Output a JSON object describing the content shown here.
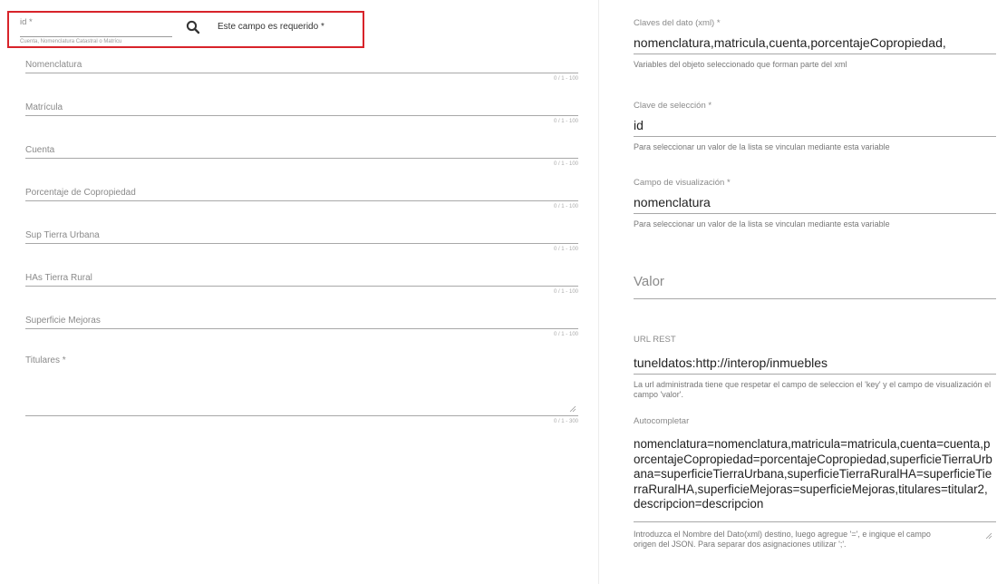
{
  "left": {
    "id_field": {
      "label": "id *",
      "hint": "Cuenta, Nomenclatura Catastral o Matrícu",
      "required_message": "Este campo es requerido *",
      "search_icon": "search-icon"
    },
    "fields": [
      {
        "label": "Nomenclatura",
        "counter": "0 / 1 - 100"
      },
      {
        "label": "Matrícula",
        "counter": "0 / 1 - 100"
      },
      {
        "label": "Cuenta",
        "counter": "0 / 1 - 100"
      },
      {
        "label": "Porcentaje de Copropiedad",
        "counter": "0 / 1 - 100"
      },
      {
        "label": "Sup Tierra Urbana",
        "counter": "0 / 1 - 100"
      },
      {
        "label": "HAs Tierra Rural",
        "counter": "0 / 1 - 100"
      },
      {
        "label": "Superficie Mejoras",
        "counter": "0 / 1 - 100"
      }
    ],
    "titulares": {
      "label": "Titulares *",
      "counter": "0 / 1 - 300"
    }
  },
  "right": {
    "claves": {
      "label": "Claves del dato (xml) *",
      "value": "nomenclatura,matricula,cuenta,porcentajeCopropiedad,",
      "hint": "Variables del objeto seleccionado que forman parte del xml"
    },
    "clave_seleccion": {
      "label": "Clave de selección *",
      "value": "id",
      "hint": "Para seleccionar un valor de la lista se vinculan mediante esta variable"
    },
    "campo_visualizacion": {
      "label": "Campo de visualización *",
      "value": "nomenclatura",
      "hint": "Para seleccionar un valor de la lista se vinculan mediante esta variable"
    },
    "valor": {
      "placeholder": "Valor"
    },
    "url_rest": {
      "label": "URL REST",
      "value": "tuneldatos:http://interop/inmuebles",
      "hint": "La url administrada tiene que respetar el campo de seleccion el 'key' y el campo de visualización el campo 'valor'."
    },
    "autocompletar": {
      "label": "Autocompletar",
      "value": "nomenclatura=nomenclatura,matricula=matricula,cuenta=cuenta,porcentajeCopropiedad=porcentajeCopropiedad,superficieTierraUrbana=superficieTierraUrbana,superficieTierraRuralHA=superficieTierraRuralHA,superficieMejoras=superficieMejoras,titulares=titular2,descripcion=descripcion",
      "hint": "Introduzca el Nombre del Dato(xml) destino, luego agregue '=', e ingique el campo origen del JSON. Para separar dos asignaciones utilizar ';'."
    }
  }
}
